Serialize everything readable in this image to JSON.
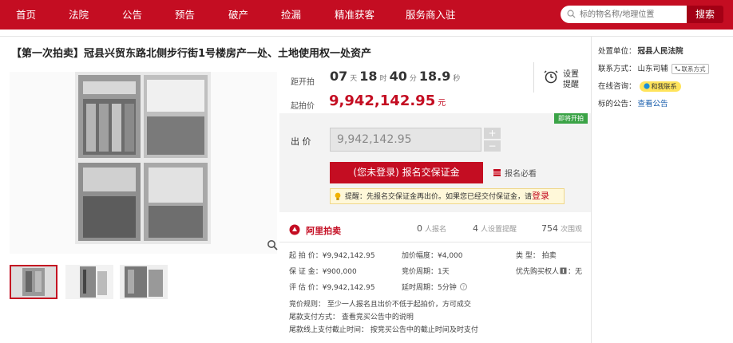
{
  "nav": {
    "items": [
      "首页",
      "法院",
      "公告",
      "预告",
      "破产",
      "捡漏",
      "精准获客",
      "服务商入驻"
    ]
  },
  "search": {
    "placeholder": "标的物名称/地理位置",
    "button": "搜索"
  },
  "auction": {
    "title": "【第一次拍卖】冠县兴贸东路北侧步行街1号楼房产一处、土地使用权一处资产",
    "countdown_label": "距开拍",
    "days": "07",
    "days_unit": "天",
    "hours": "18",
    "hours_unit": "时",
    "minutes": "40",
    "minutes_unit": "分",
    "seconds": "18.9",
    "seconds_unit": "秒",
    "start_label": "起拍价",
    "start_price": "9,942,142.95",
    "currency": "元",
    "remind_label_1": "设置",
    "remind_label_2": "提醒",
    "badge": "即将开拍",
    "bid_label": "出  价",
    "bid_value": "9,942,142.95",
    "stepper_plus": "+",
    "stepper_minus": "−",
    "register_button": "(您未登录) 报名交保证金",
    "must_read": "报名必看",
    "tip_prefix": "提醒：",
    "tip_text": "先报名交保证金再出价。如果您已经交付保证金，请",
    "tip_login": "登录"
  },
  "stats": {
    "logo": "阿里拍卖",
    "signup_count": "0",
    "signup_label": "人报名",
    "remind_count": "4",
    "remind_label": "人设置提醒",
    "views_count": "754",
    "views_label": "次围观"
  },
  "details": {
    "start_price": "起 拍 价：¥9,942,142.95",
    "deposit": "保 证 金：¥900,000",
    "valuation": "评 估 价：¥9,942,142.95",
    "increment": "加价幅度：¥4,000",
    "period": "竞价周期：1天",
    "extension": "延时周期：5分钟",
    "type": "类    型：  拍卖",
    "priority": "优先购买权人",
    "priority_value": "：无",
    "rule": "竞价规则：  至少一人报名且出价不低于起拍价，方可成交",
    "payment_method": "尾款支付方式：  查看竞买公告中的说明",
    "payment_deadline": "尾款线上支付截止时间：  按竞买公告中的截止时间及时支付"
  },
  "sidebar": {
    "unit_label": "处置单位：",
    "unit_value": "冠县人民法院",
    "contact_label": "联系方式：",
    "contact_value": "山东司辅",
    "contact_tag": "联系方式",
    "consult_label": "在线咨询：",
    "consult_value": "和我联系",
    "notice_label": "标的公告：",
    "notice_value": "查看公告"
  },
  "colors": {
    "brand": "#c40d22",
    "badge": "#3aa346",
    "link": "#1b5fad"
  }
}
